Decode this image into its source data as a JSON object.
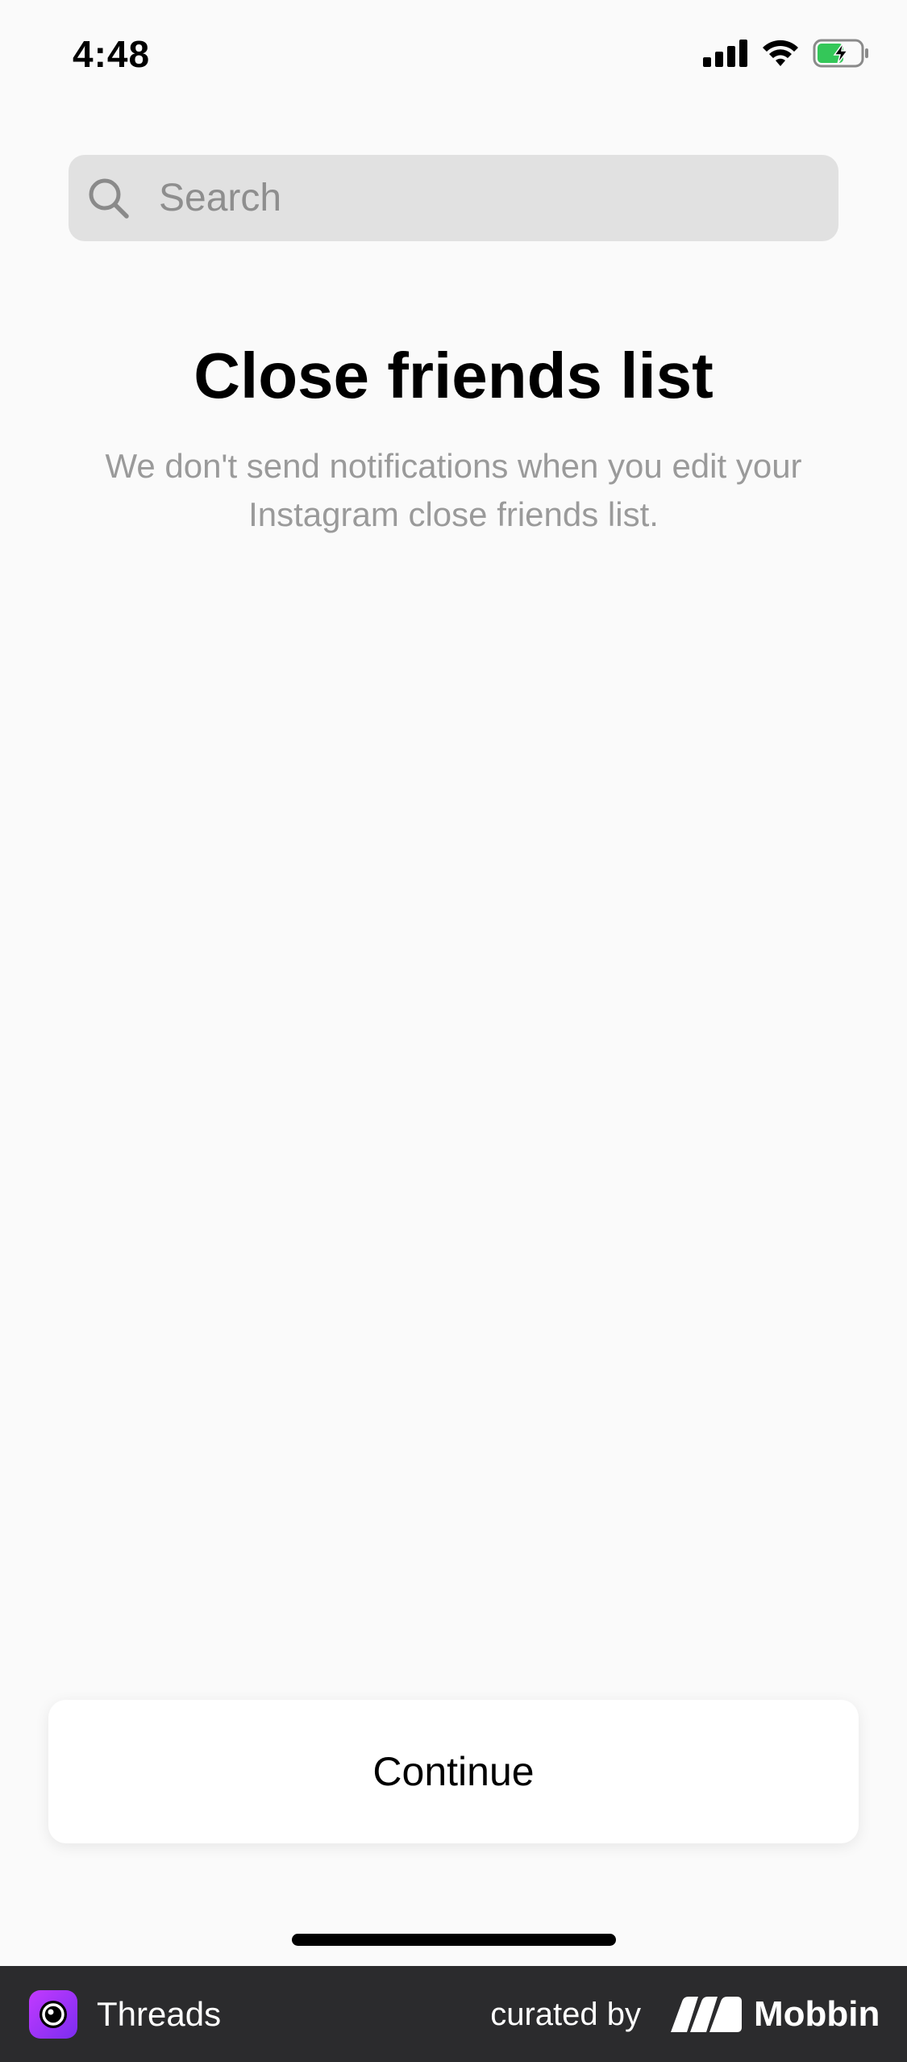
{
  "status_bar": {
    "time": "4:48",
    "icons": [
      "signal-icon",
      "wifi-icon",
      "battery-charging-icon"
    ]
  },
  "search": {
    "placeholder": "Search",
    "value": ""
  },
  "main": {
    "title": "Close friends list",
    "subtitle": "We don't send notifications when you edit your Instagram close friends list."
  },
  "actions": {
    "continue_label": "Continue"
  },
  "footer": {
    "app_name": "Threads",
    "curated_label": "curated by",
    "brand": "Mobbin"
  },
  "colors": {
    "background": "#fafafa",
    "search_background": "#e1e1e1",
    "subtitle_text": "#9a9a9a",
    "battery_green": "#34c759",
    "footer_background": "#2b2b2d"
  }
}
